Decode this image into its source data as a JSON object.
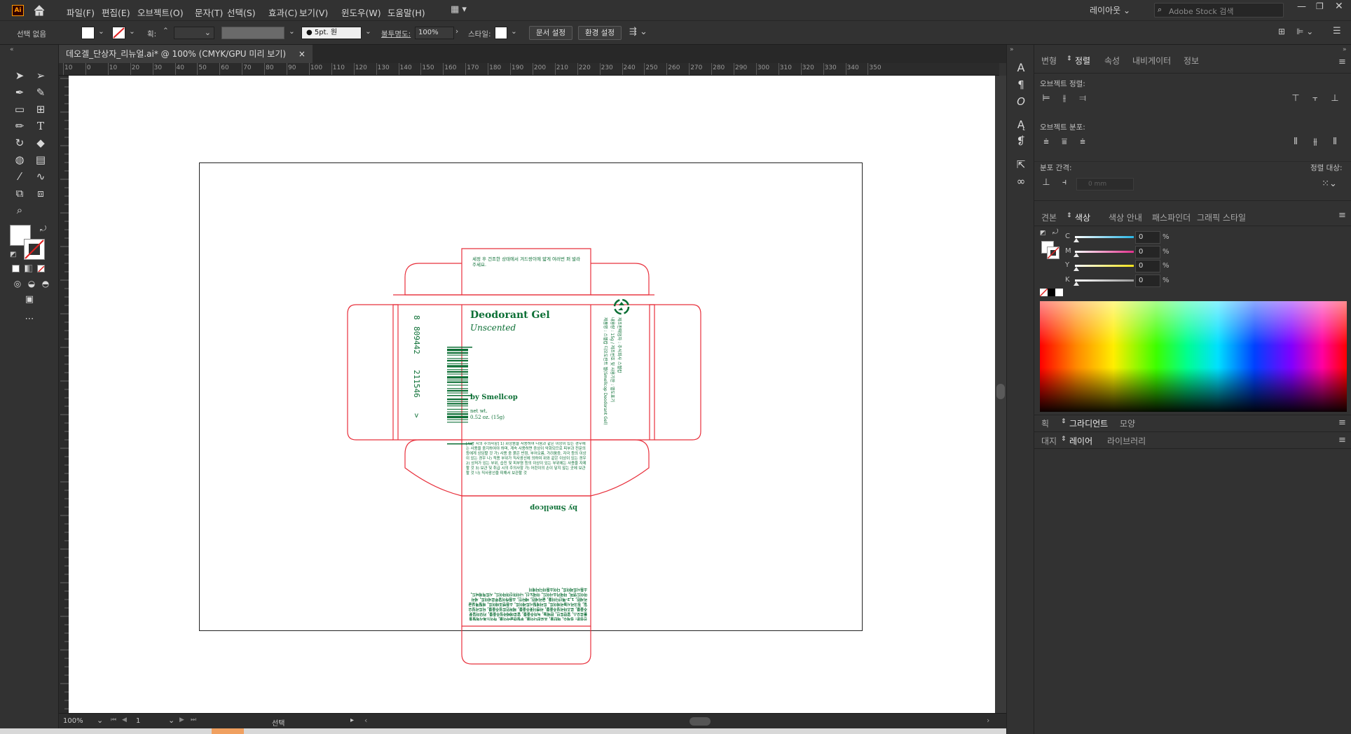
{
  "app": {
    "logo": "Ai",
    "home_icon": "home-icon"
  },
  "menu": [
    "파일(F)",
    "편집(E)",
    "오브젝트(O)",
    "문자(T)",
    "선택(S)",
    "효과(C)",
    "보기(V)",
    "윈도우(W)",
    "도움말(H)"
  ],
  "header_right": {
    "workspace": "레이아웃",
    "search_placeholder": "Adobe Stock 검색"
  },
  "control_bar": {
    "selection": "선택 없음",
    "stroke_label": "획:",
    "brush": "5pt. 원",
    "opacity_label": "불투명도:",
    "opacity_value": "100%",
    "style_label": "스타일:",
    "doc_setup": "문서 설정",
    "preferences": "환경 설정"
  },
  "document_tab": {
    "title": "데오겔_단상자_리뉴얼.ai* @ 100% (CMYK/GPU 미리 보기)",
    "close": "×"
  },
  "ruler_ticks": [
    "10",
    "0",
    "10",
    "20",
    "30",
    "40",
    "50",
    "60",
    "70",
    "80",
    "90",
    "100",
    "110",
    "120",
    "130",
    "140",
    "150",
    "160",
    "170",
    "180",
    "190",
    "200",
    "210",
    "220",
    "230",
    "240",
    "250",
    "260",
    "270",
    "280",
    "290",
    "300",
    "310",
    "320",
    "330",
    "340",
    "350"
  ],
  "dieline": {
    "line_color": "#e8303c",
    "ink_color": "#0c6f35",
    "top_flap_text": "세정 후 건조한 상태에서 겨드랑이에 얇게 여러번 펴 발라주세요.",
    "product_name": "Deodorant Gel",
    "variant": "Unscented",
    "brand": "by Smellcop",
    "net_wt_label": "net wt.",
    "net_wt_value": "0.52 oz. (15g)",
    "barcode_left": "8",
    "barcode_mid": "809442",
    "barcode_right": "211546",
    "barcode_arrow": ">",
    "side_info_1": "제품명 : 스멜캅 디오도란트 젤(Smellcop Deodorant Gel)",
    "side_info_2": "내용량 : 15g / 제조번호 및 사용기한 : 별도표기",
    "side_info_3": "제조판매업자 : 주식회사 스멜캅",
    "caution_text": "[사용 시의 주의사항] 1) 화장품을 사용하여 다음과 같은 이상이 있는 경우에는 사용을 중지하여야 하며, 계속 사용하면 증상이 악화되므로 피부과 전문의 등에게 상담할 것 가) 사용 중 붉은 반점, 부어오름, 가려움증, 자극 등의 이상이 있는 경우 나) 적용 부위가 직사광선에 의하여 위와 같은 이상이 있는 경우 2) 상처가 있는 부위, 습진 및 피부염 등의 이상이 있는 부위에는 사용을 자제할 것 3) 보관 및 취급 시의 주의사항 가) 어린이의 손이 닿지 않는 곳에 보관할 것 나) 직사광선을 피해서 보관할 것",
    "bottom_brand": "by Smellcop",
    "ingredients_text": "전성분: 정제수, 에탄올, 프로판다이올, 부틸렌글라이콜, 하이드록시에틸셀룰로오스, 알란토인, 판테놀, 녹차추출물, 알로에베라잎추출물, 카모마일꽃추출물, 로즈마리잎추출물, 라벤더꽃추출물, 페퍼민트잎추출물, 티트리잎오일, 징크리시놀리에이트, 트리에틸시트레이트, 소듐벤조에이트, 에틸헥실글리세린, 1,2-헥산다이올, 글리세린, 베타인, 소듐하이알루로네이트, 세라마이드엔피, 마데카소사이드, 아데노신, 나이아신아마이드, 시트릭애씨드, 소듐시트레이트, 다이소듐이디티에이"
  },
  "status_bar": {
    "zoom": "100%",
    "artboard": "1",
    "tool": "선택"
  },
  "panel_tabs_1": [
    "변형",
    "정렬",
    "속성",
    "내비게이터",
    "정보"
  ],
  "panel_tabs_1_active": "정렬",
  "align": {
    "objects_label": "오브젝트 정렬:",
    "distribute_label": "오브젝트 분포:",
    "spacing_label": "분포 간격:",
    "align_to_label": "정렬 대상:",
    "spacing_value": "0 mm"
  },
  "panel_tabs_2": [
    "견본",
    "색상",
    "색상 안내",
    "패스파인더",
    "그래픽 스타일"
  ],
  "panel_tabs_2_active": "색상",
  "cmyk": [
    {
      "channel": "C",
      "value": "0",
      "color": "#29b6e6"
    },
    {
      "channel": "M",
      "value": "0",
      "color": "#e0308c"
    },
    {
      "channel": "Y",
      "value": "0",
      "color": "#f2e21a"
    },
    {
      "channel": "K",
      "value": "0",
      "color": "#9a9a9a"
    }
  ],
  "percent": "%",
  "panel_tabs_3": [
    "획",
    "그라디언트",
    "모양"
  ],
  "panel_tabs_3_active": "그라디언트",
  "panel_tabs_4": [
    "대지",
    "레이어",
    "라이브러리"
  ],
  "panel_tabs_4_active": "레이어"
}
